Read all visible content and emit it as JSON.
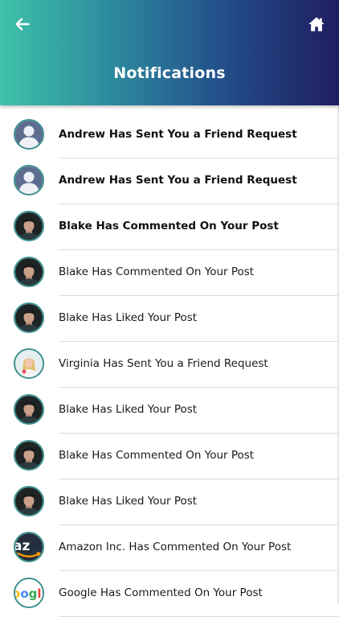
{
  "header": {
    "title": "Notifications",
    "back_icon": "arrow-left-icon",
    "home_icon": "home-icon",
    "colors": {
      "gradient_start": "#3ec2a8",
      "gradient_end": "#1f1d62"
    }
  },
  "notifications": [
    {
      "text": "Andrew Has Sent You a Friend Request",
      "avatar": "default-user",
      "unread": true
    },
    {
      "text": "Andrew Has Sent You a Friend Request",
      "avatar": "default-user",
      "unread": true
    },
    {
      "text": "Blake Has Commented On Your Post",
      "avatar": "blake-photo",
      "unread": true
    },
    {
      "text": "Blake Has Commented On Your Post",
      "avatar": "blake-photo",
      "unread": false
    },
    {
      "text": "Blake Has Liked Your Post",
      "avatar": "blake-photo",
      "unread": false
    },
    {
      "text": "Virginia Has Sent You a Friend Request",
      "avatar": "virginia-photo",
      "unread": false
    },
    {
      "text": "Blake Has Liked Your Post",
      "avatar": "blake-photo",
      "unread": false
    },
    {
      "text": "Blake Has Commented On Your Post",
      "avatar": "blake-photo",
      "unread": false
    },
    {
      "text": "Blake Has Liked Your Post",
      "avatar": "blake-photo",
      "unread": false
    },
    {
      "text": "Amazon Inc. Has Commented On Your Post",
      "avatar": "amazon-logo",
      "unread": false
    },
    {
      "text": "Google Has Commented On Your Post",
      "avatar": "google-logo",
      "unread": false
    }
  ]
}
